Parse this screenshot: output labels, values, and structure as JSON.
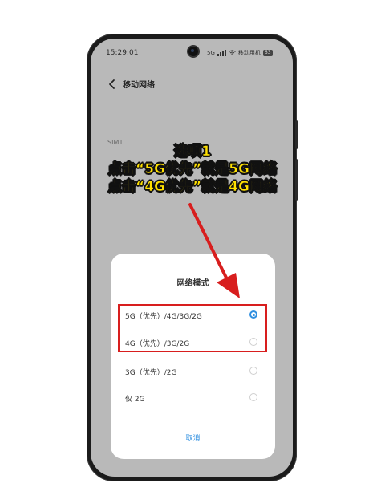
{
  "status_bar": {
    "time": "15:29:01",
    "network": "5G",
    "carrier": "移动用机",
    "battery": "63"
  },
  "header": {
    "title": "移动网络"
  },
  "sim_section": {
    "label": "SIM1"
  },
  "dialog": {
    "title": "网络模式",
    "options": [
      {
        "label": "5G（优先）/4G/3G/2G",
        "selected": true
      },
      {
        "label": "4G（优先）/3G/2G",
        "selected": false
      },
      {
        "label": "3G（优先）/2G",
        "selected": false
      },
      {
        "label": "仅 2G",
        "selected": false
      }
    ],
    "cancel_label": "取消"
  },
  "annotation": {
    "line1": "选项1",
    "line2": "点击“5G优先”就是5G网络",
    "line3": "点击“4G优先”就是4G网络"
  },
  "colors": {
    "accent": "#2f8fe0",
    "highlight": "#d81e1e",
    "annotation_text": "#ffe000"
  }
}
